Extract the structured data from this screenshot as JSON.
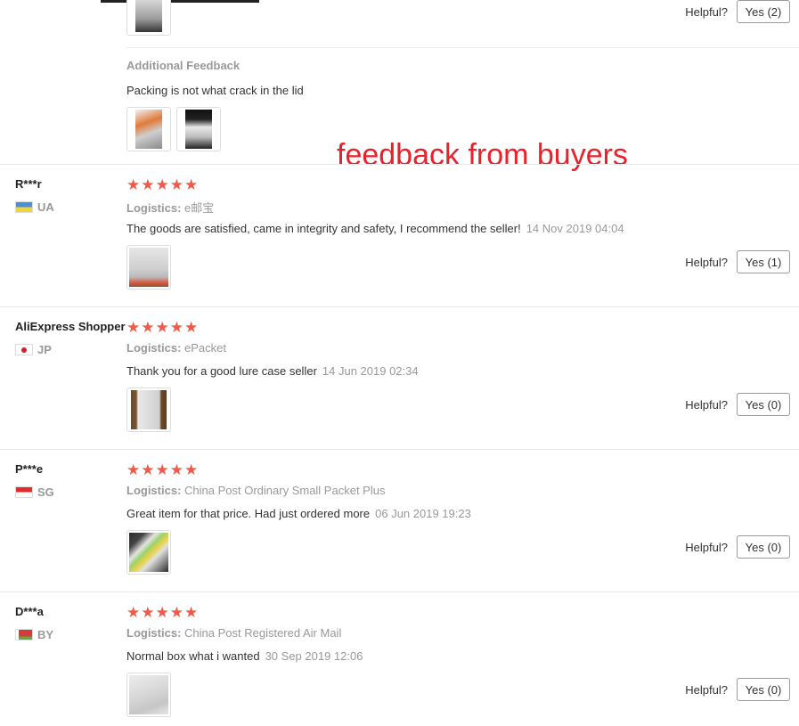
{
  "annotation": "feedback from buyers",
  "top_review": {
    "helpful_label": "Helpful?",
    "yes_label": "Yes (2)",
    "additional_title": "Additional Feedback",
    "additional_text": "Packing is not what crack in the lid"
  },
  "reviews": [
    {
      "name": "R***r",
      "country": "UA",
      "stars": "★★★★★",
      "logistics_label": "Logistics:",
      "logistics_value": "e邮宝",
      "comment": "The goods are satisfied, came in integrity and safety, I recommend the seller!",
      "date": "14 Nov 2019 04:04",
      "helpful_label": "Helpful?",
      "yes_label": "Yes (1)"
    },
    {
      "name": "AliExpress Shopper",
      "country": "JP",
      "stars": "★★★★★",
      "logistics_label": "Logistics:",
      "logistics_value": "ePacket",
      "comment": "Thank you for a good lure case seller",
      "date": "14 Jun 2019 02:34",
      "helpful_label": "Helpful?",
      "yes_label": "Yes (0)"
    },
    {
      "name": "P***e",
      "country": "SG",
      "stars": "★★★★★",
      "logistics_label": "Logistics:",
      "logistics_value": "China Post Ordinary Small Packet Plus",
      "comment": "Great item for that price. Had just ordered more",
      "date": "06 Jun 2019 19:23",
      "helpful_label": "Helpful?",
      "yes_label": "Yes (0)"
    },
    {
      "name": "D***a",
      "country": "BY",
      "stars": "★★★★★",
      "logistics_label": "Logistics:",
      "logistics_value": "China Post Registered Air Mail",
      "comment": "Normal box what i wanted",
      "date": "30 Sep 2019 12:06",
      "helpful_label": "Helpful?",
      "yes_label": "Yes (0)"
    }
  ]
}
